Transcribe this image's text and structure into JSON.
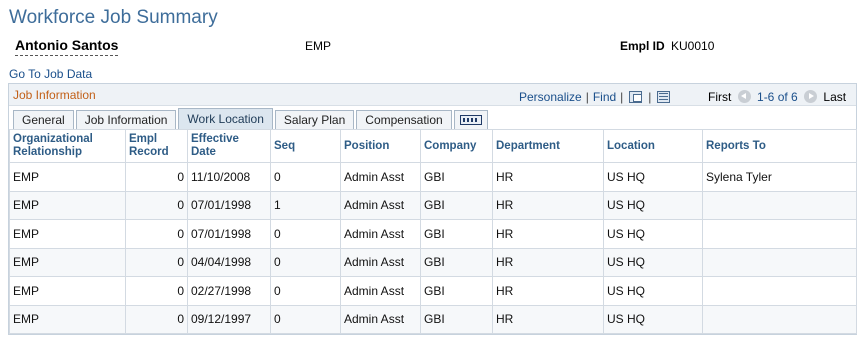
{
  "page": {
    "title": "Workforce Job Summary",
    "employee_name": "Antonio Santos",
    "org_relationship": "EMP",
    "emplid_label": "Empl ID",
    "emplid_value": "KU0010",
    "goto_link": "Go To Job Data"
  },
  "grid": {
    "title": "Job Information",
    "personalize": "Personalize",
    "find": "Find",
    "separator": "|",
    "pager": {
      "first": "First",
      "range": "1-6 of 6",
      "last": "Last"
    },
    "tabs": [
      {
        "label": "General"
      },
      {
        "label": "Job Information"
      },
      {
        "label": "Work Location",
        "active": true
      },
      {
        "label": "Salary Plan"
      },
      {
        "label": "Compensation"
      }
    ],
    "columns": {
      "org_rel": "Organizational Relationship",
      "empl_rcd": "Empl Record",
      "eff_date": "Effective Date",
      "seq": "Seq",
      "position": "Position",
      "company": "Company",
      "department": "Department",
      "location": "Location",
      "reports_to": "Reports To"
    },
    "rows": [
      {
        "org_rel": "EMP",
        "empl_rcd": "0",
        "eff_date": "11/10/2008",
        "seq": "0",
        "position": "Admin Asst",
        "company": "GBI",
        "department": "HR",
        "location": "US HQ",
        "reports_to": "Sylena Tyler"
      },
      {
        "org_rel": "EMP",
        "empl_rcd": "0",
        "eff_date": "07/01/1998",
        "seq": "1",
        "position": "Admin Asst",
        "company": "GBI",
        "department": "HR",
        "location": "US HQ",
        "reports_to": ""
      },
      {
        "org_rel": "EMP",
        "empl_rcd": "0",
        "eff_date": "07/01/1998",
        "seq": "0",
        "position": "Admin Asst",
        "company": "GBI",
        "department": "HR",
        "location": "US HQ",
        "reports_to": ""
      },
      {
        "org_rel": "EMP",
        "empl_rcd": "0",
        "eff_date": "04/04/1998",
        "seq": "0",
        "position": "Admin Asst",
        "company": "GBI",
        "department": "HR",
        "location": "US HQ",
        "reports_to": ""
      },
      {
        "org_rel": "EMP",
        "empl_rcd": "0",
        "eff_date": "02/27/1998",
        "seq": "0",
        "position": "Admin Asst",
        "company": "GBI",
        "department": "HR",
        "location": "US HQ",
        "reports_to": ""
      },
      {
        "org_rel": "EMP",
        "empl_rcd": "0",
        "eff_date": "09/12/1997",
        "seq": "0",
        "position": "Admin Asst",
        "company": "GBI",
        "department": "HR",
        "location": "US HQ",
        "reports_to": ""
      }
    ]
  }
}
